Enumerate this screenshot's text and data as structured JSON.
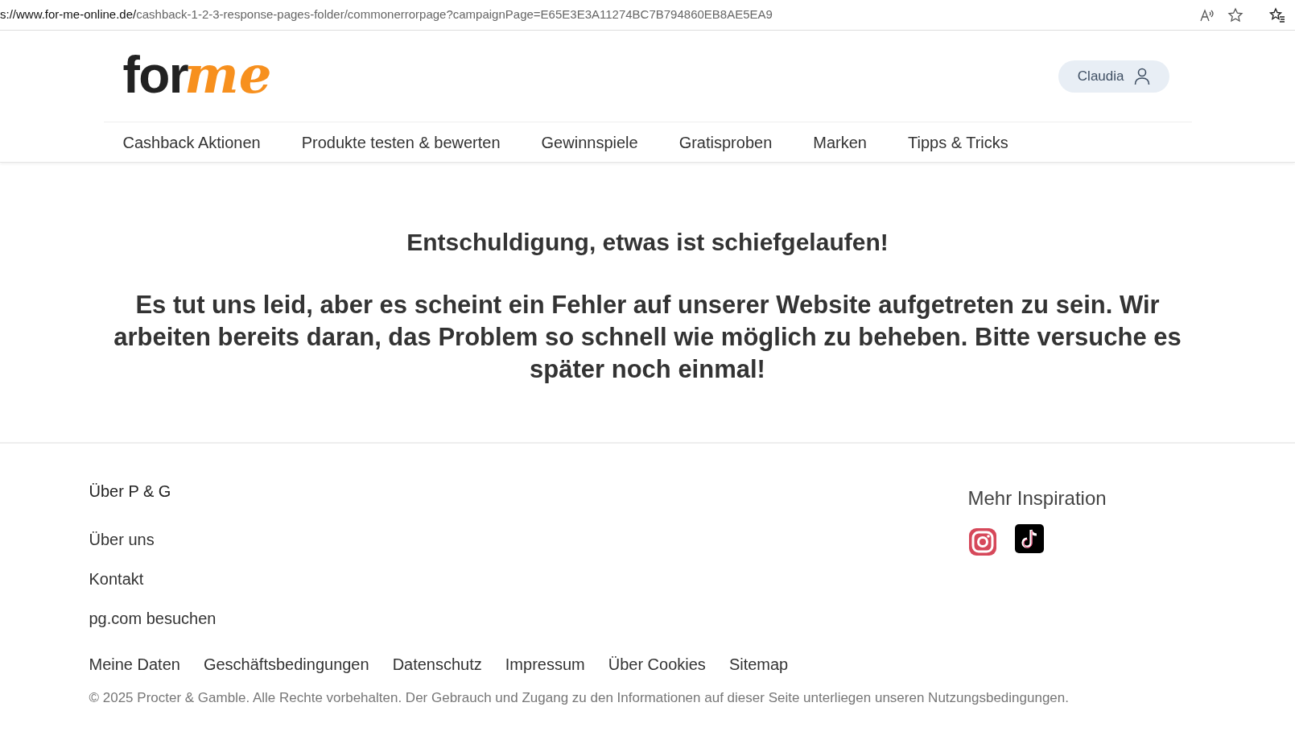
{
  "address_bar": {
    "url_host": "s://www.for-me-online.de/",
    "url_path": "cashback-1-2-3-response-pages-folder/commonerrorpage?campaignPage=E65E3E3A11274BC7B794860EB8AE5EA9"
  },
  "header": {
    "logo": {
      "part_1": "for",
      "part_2": "me"
    },
    "user_button": "Claudia"
  },
  "nav": [
    "Cashback Aktionen",
    "Produkte testen & bewerten",
    "Gewinnspiele",
    "Gratisproben",
    "Marken",
    "Tipps & Tricks"
  ],
  "error": {
    "title": "Entschuldigung, etwas ist schiefgelaufen!",
    "message": "Es tut uns leid, aber es scheint ein Fehler auf unserer Website aufgetreten zu sein. Wir arbeiten bereits daran, das Problem so schnell wie möglich zu beheben. Bitte versuche es später noch einmal!"
  },
  "footer": {
    "about_heading": "Über P & G",
    "about_links": [
      "Über uns",
      "Kontakt",
      "pg.com besuchen"
    ],
    "inspiration_heading": "Mehr Inspiration",
    "legal_links": [
      "Meine Daten",
      "Geschäftsbedingungen",
      "Datenschutz",
      "Impressum",
      "Über Cookies",
      "Sitemap"
    ],
    "copyright": "© 2025 Procter & Gamble. Alle Rechte vorbehalten. Der Gebrauch und Zugang zu den Informationen auf dieser Seite unterliegen unseren Nutzungsbedingungen."
  }
}
